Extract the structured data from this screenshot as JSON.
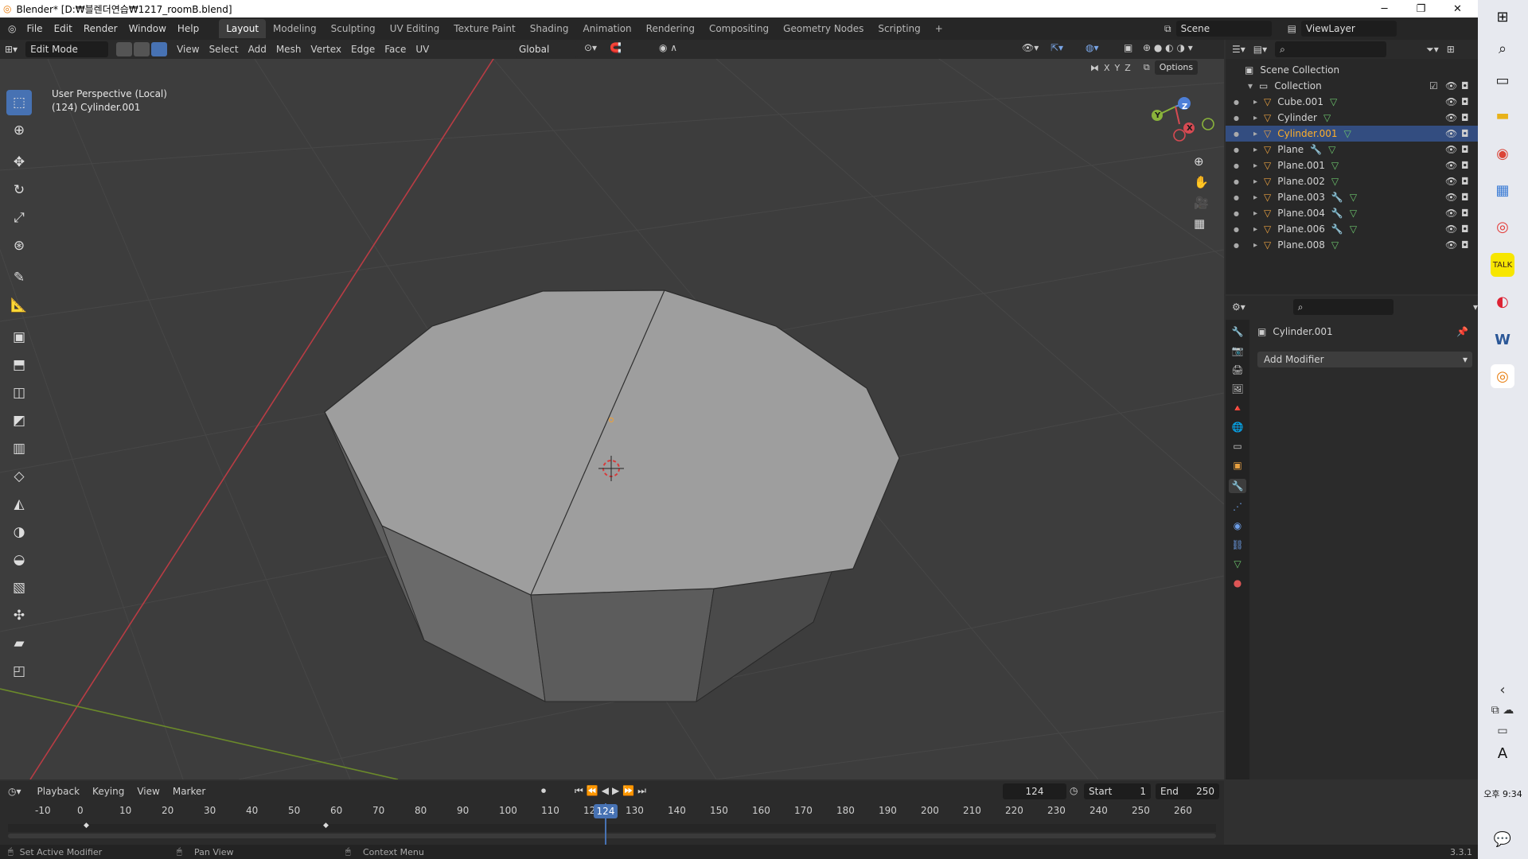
{
  "window": {
    "title": "Blender* [D:₩블렌더연습₩1217_roomB.blend]",
    "min": "─",
    "max": "❐",
    "close": "✕"
  },
  "menu": [
    "File",
    "Edit",
    "Render",
    "Window",
    "Help"
  ],
  "workspaces": [
    "Layout",
    "Modeling",
    "Sculpting",
    "UV Editing",
    "Texture Paint",
    "Shading",
    "Animation",
    "Rendering",
    "Compositing",
    "Geometry Nodes",
    "Scripting",
    "+"
  ],
  "scene": {
    "label": "Scene",
    "view_layer": "ViewLayer"
  },
  "viewport_header": {
    "mode": "Edit Mode",
    "items": [
      "View",
      "Select",
      "Add",
      "Mesh",
      "Vertex",
      "Edge",
      "Face",
      "UV"
    ],
    "transform": "Global",
    "options": "Options",
    "axes": [
      "X",
      "Y",
      "Z"
    ]
  },
  "viewport": {
    "perspective": "User Perspective (Local)",
    "object_info": "(124) Cylinder.001",
    "gizmo": {
      "x": "X",
      "y": "Y",
      "z": "Z"
    }
  },
  "outliner": {
    "scene_collection": "Scene Collection",
    "collection": "Collection",
    "objects": [
      {
        "name": "Cube.001",
        "modifier": false,
        "selected": false
      },
      {
        "name": "Cylinder",
        "modifier": false,
        "selected": false
      },
      {
        "name": "Cylinder.001",
        "modifier": false,
        "selected": true
      },
      {
        "name": "Plane",
        "modifier": true,
        "selected": false
      },
      {
        "name": "Plane.001",
        "modifier": false,
        "selected": false
      },
      {
        "name": "Plane.002",
        "modifier": false,
        "selected": false
      },
      {
        "name": "Plane.003",
        "modifier": true,
        "selected": false
      },
      {
        "name": "Plane.004",
        "modifier": true,
        "selected": false
      },
      {
        "name": "Plane.006",
        "modifier": true,
        "selected": false
      },
      {
        "name": "Plane.008",
        "modifier": false,
        "selected": false
      }
    ]
  },
  "properties": {
    "object": "Cylinder.001",
    "add_modifier": "Add Modifier"
  },
  "timeline": {
    "menus": [
      "Playback",
      "Keying",
      "View",
      "Marker"
    ],
    "current": "124",
    "start_label": "Start",
    "start": "1",
    "end_label": "End",
    "end": "250",
    "ticks": [
      "-10",
      "0",
      "10",
      "20",
      "30",
      "40",
      "50",
      "60",
      "70",
      "80",
      "90",
      "100",
      "110",
      "120",
      "130",
      "140",
      "150",
      "160",
      "170",
      "180",
      "190",
      "200",
      "210",
      "220",
      "230",
      "240",
      "250",
      "260"
    ]
  },
  "status": {
    "left": "Set Active Modifier",
    "mid": "Pan View",
    "right": "Context Menu",
    "version": "3.3.1"
  },
  "taskbar": {
    "time": "오후 9:34",
    "lang": "A"
  }
}
